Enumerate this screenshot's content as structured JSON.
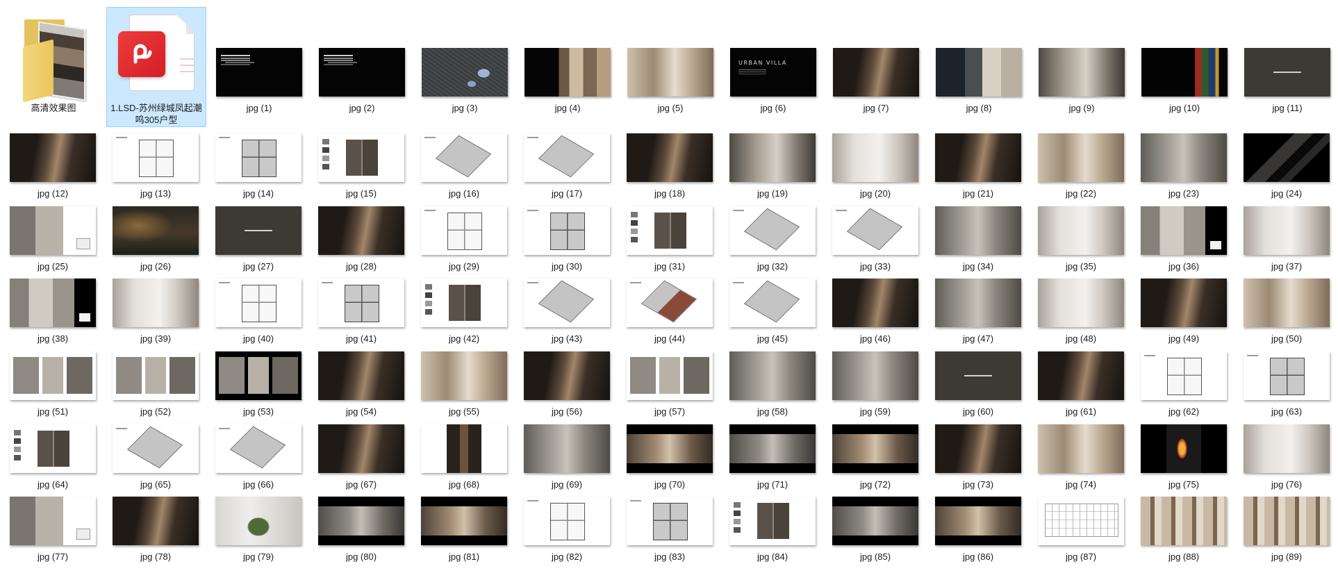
{
  "colors": {
    "selection_background": "#cce8ff",
    "selection_border": "#99d1ff",
    "label_text": "#1a1a1a"
  },
  "items": [
    {
      "type": "folder",
      "icon": "folder-icon",
      "label": "高清效果图"
    },
    {
      "type": "pdf",
      "icon": "pdf-file-icon",
      "label": "1.LSD-苏州绿城凤起潮鸣305户型",
      "selected": true
    },
    {
      "type": "jpg",
      "label": "jpg (1)"
    },
    {
      "type": "jpg",
      "label": "jpg (2)"
    },
    {
      "type": "jpg",
      "label": "jpg (3)"
    },
    {
      "type": "jpg",
      "label": "jpg (4)"
    },
    {
      "type": "jpg",
      "label": "jpg (5)"
    },
    {
      "type": "jpg",
      "label": "jpg (6)",
      "thumb_text": "URBAN VILLA"
    },
    {
      "type": "jpg",
      "label": "jpg (7)"
    },
    {
      "type": "jpg",
      "label": "jpg (8)"
    },
    {
      "type": "jpg",
      "label": "jpg (9)"
    },
    {
      "type": "jpg",
      "label": "jpg (10)"
    },
    {
      "type": "jpg",
      "label": "jpg (11)"
    },
    {
      "type": "jpg",
      "label": "jpg (12)"
    },
    {
      "type": "jpg",
      "label": "jpg (13)"
    },
    {
      "type": "jpg",
      "label": "jpg (14)"
    },
    {
      "type": "jpg",
      "label": "jpg (15)"
    },
    {
      "type": "jpg",
      "label": "jpg (16)"
    },
    {
      "type": "jpg",
      "label": "jpg (17)"
    },
    {
      "type": "jpg",
      "label": "jpg (18)"
    },
    {
      "type": "jpg",
      "label": "jpg (19)"
    },
    {
      "type": "jpg",
      "label": "jpg (20)"
    },
    {
      "type": "jpg",
      "label": "jpg (21)"
    },
    {
      "type": "jpg",
      "label": "jpg (22)"
    },
    {
      "type": "jpg",
      "label": "jpg (23)"
    },
    {
      "type": "jpg",
      "label": "jpg (24)"
    },
    {
      "type": "jpg",
      "label": "jpg (25)"
    },
    {
      "type": "jpg",
      "label": "jpg (26)"
    },
    {
      "type": "jpg",
      "label": "jpg (27)"
    },
    {
      "type": "jpg",
      "label": "jpg (28)"
    },
    {
      "type": "jpg",
      "label": "jpg (29)"
    },
    {
      "type": "jpg",
      "label": "jpg (30)"
    },
    {
      "type": "jpg",
      "label": "jpg (31)"
    },
    {
      "type": "jpg",
      "label": "jpg (32)"
    },
    {
      "type": "jpg",
      "label": "jpg (33)"
    },
    {
      "type": "jpg",
      "label": "jpg (34)"
    },
    {
      "type": "jpg",
      "label": "jpg (35)"
    },
    {
      "type": "jpg",
      "label": "jpg (36)"
    },
    {
      "type": "jpg",
      "label": "jpg (37)"
    },
    {
      "type": "jpg",
      "label": "jpg (38)"
    },
    {
      "type": "jpg",
      "label": "jpg (39)"
    },
    {
      "type": "jpg",
      "label": "jpg (40)"
    },
    {
      "type": "jpg",
      "label": "jpg (41)"
    },
    {
      "type": "jpg",
      "label": "jpg (42)"
    },
    {
      "type": "jpg",
      "label": "jpg (43)"
    },
    {
      "type": "jpg",
      "label": "jpg (44)"
    },
    {
      "type": "jpg",
      "label": "jpg (45)"
    },
    {
      "type": "jpg",
      "label": "jpg (46)"
    },
    {
      "type": "jpg",
      "label": "jpg (47)"
    },
    {
      "type": "jpg",
      "label": "jpg (48)"
    },
    {
      "type": "jpg",
      "label": "jpg (49)"
    },
    {
      "type": "jpg",
      "label": "jpg (50)"
    },
    {
      "type": "jpg",
      "label": "jpg (51)"
    },
    {
      "type": "jpg",
      "label": "jpg (52)"
    },
    {
      "type": "jpg",
      "label": "jpg (53)"
    },
    {
      "type": "jpg",
      "label": "jpg (54)"
    },
    {
      "type": "jpg",
      "label": "jpg (55)"
    },
    {
      "type": "jpg",
      "label": "jpg (56)"
    },
    {
      "type": "jpg",
      "label": "jpg (57)"
    },
    {
      "type": "jpg",
      "label": "jpg (58)"
    },
    {
      "type": "jpg",
      "label": "jpg (59)"
    },
    {
      "type": "jpg",
      "label": "jpg (60)"
    },
    {
      "type": "jpg",
      "label": "jpg (61)"
    },
    {
      "type": "jpg",
      "label": "jpg (62)"
    },
    {
      "type": "jpg",
      "label": "jpg (63)"
    },
    {
      "type": "jpg",
      "label": "jpg (64)"
    },
    {
      "type": "jpg",
      "label": "jpg (65)"
    },
    {
      "type": "jpg",
      "label": "jpg (66)"
    },
    {
      "type": "jpg",
      "label": "jpg (67)"
    },
    {
      "type": "jpg",
      "label": "jpg (68)"
    },
    {
      "type": "jpg",
      "label": "jpg (69)"
    },
    {
      "type": "jpg",
      "label": "jpg (70)"
    },
    {
      "type": "jpg",
      "label": "jpg (71)"
    },
    {
      "type": "jpg",
      "label": "jpg (72)"
    },
    {
      "type": "jpg",
      "label": "jpg (73)"
    },
    {
      "type": "jpg",
      "label": "jpg (74)"
    },
    {
      "type": "jpg",
      "label": "jpg (75)"
    },
    {
      "type": "jpg",
      "label": "jpg (76)"
    },
    {
      "type": "jpg",
      "label": "jpg (77)"
    },
    {
      "type": "jpg",
      "label": "jpg (78)"
    },
    {
      "type": "jpg",
      "label": "jpg (79)"
    },
    {
      "type": "jpg",
      "label": "jpg (80)"
    },
    {
      "type": "jpg",
      "label": "jpg (81)"
    },
    {
      "type": "jpg",
      "label": "jpg (82)"
    },
    {
      "type": "jpg",
      "label": "jpg (83)"
    },
    {
      "type": "jpg",
      "label": "jpg (84)"
    },
    {
      "type": "jpg",
      "label": "jpg (85)"
    },
    {
      "type": "jpg",
      "label": "jpg (86)"
    },
    {
      "type": "jpg",
      "label": "jpg (87)"
    },
    {
      "type": "jpg",
      "label": "jpg (88)"
    },
    {
      "type": "jpg",
      "label": "jpg (89)"
    }
  ]
}
